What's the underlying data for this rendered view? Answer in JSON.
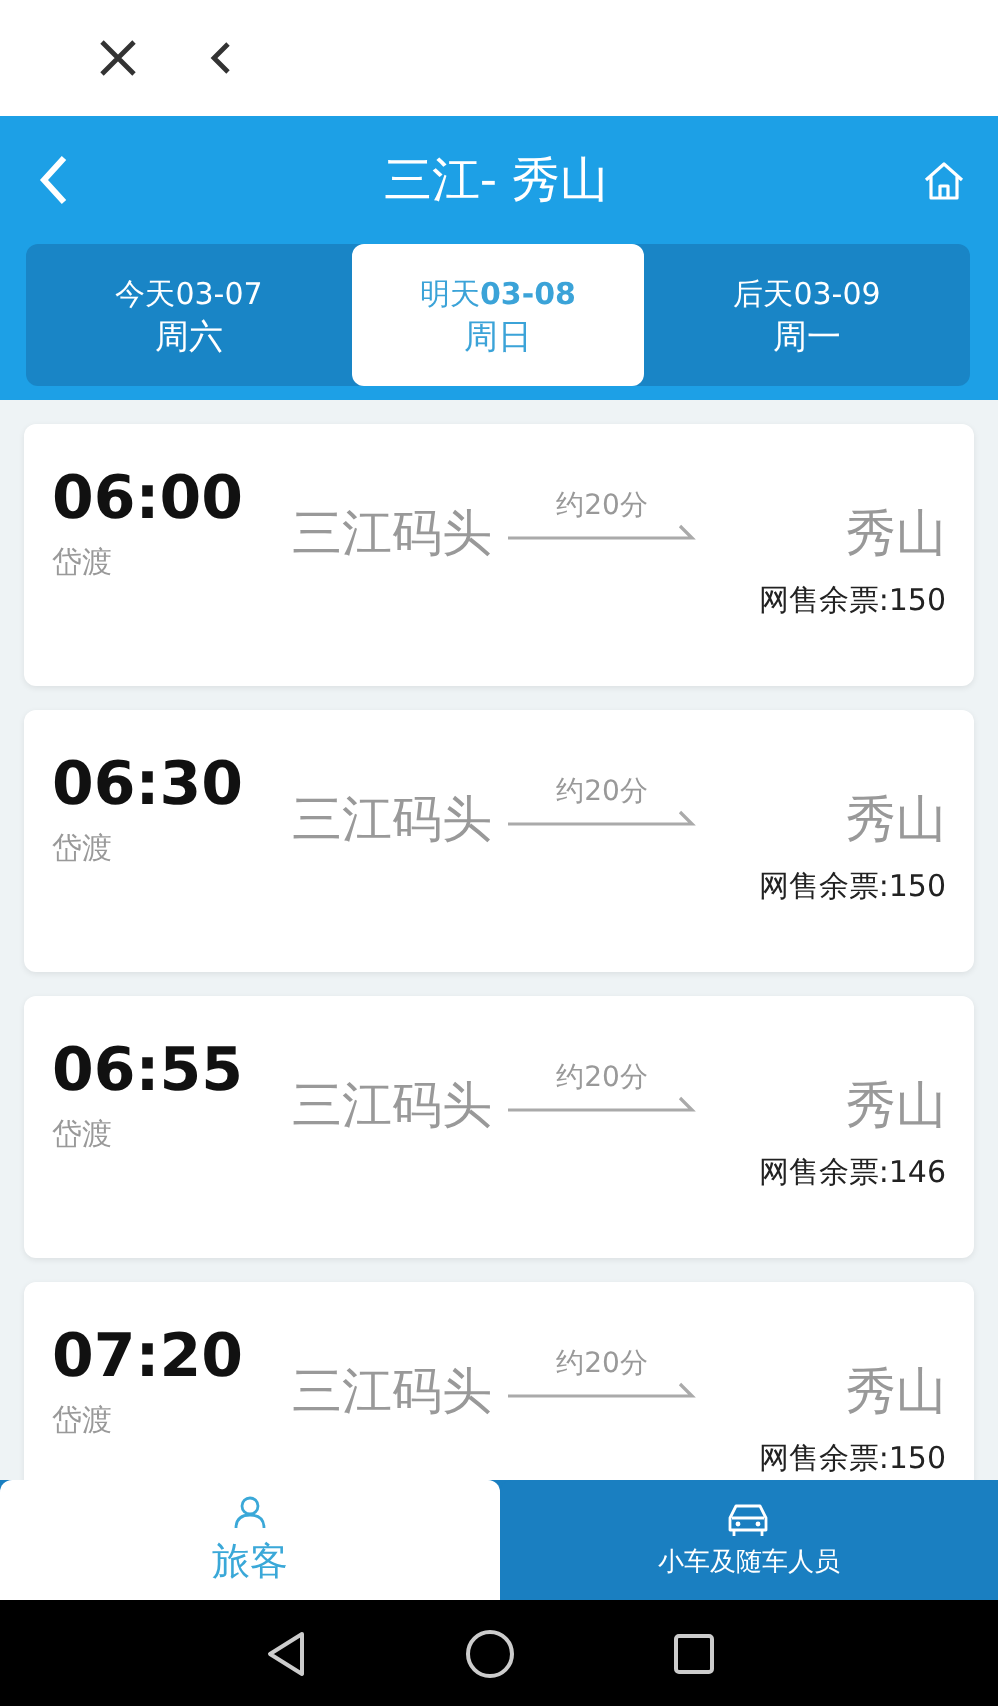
{
  "header": {
    "title": "三江- 秀山"
  },
  "date_tabs": [
    {
      "day": "今天",
      "date": "03-07",
      "weekday": "周六",
      "selected": false
    },
    {
      "day": "明天",
      "date": "03-08",
      "weekday": "周日",
      "selected": true
    },
    {
      "day": "后天",
      "date": "03-09",
      "weekday": "周一",
      "selected": false
    }
  ],
  "trips": [
    {
      "time": "06:00",
      "operator": "岱渡",
      "origin": "三江码头",
      "duration": "约20分",
      "destination": "秀山",
      "tickets": "网售余票:150"
    },
    {
      "time": "06:30",
      "operator": "岱渡",
      "origin": "三江码头",
      "duration": "约20分",
      "destination": "秀山",
      "tickets": "网售余票:150"
    },
    {
      "time": "06:55",
      "operator": "岱渡",
      "origin": "三江码头",
      "duration": "约20分",
      "destination": "秀山",
      "tickets": "网售余票:146"
    },
    {
      "time": "07:20",
      "operator": "岱渡",
      "origin": "三江码头",
      "duration": "约20分",
      "destination": "秀山",
      "tickets": "网售余票:150"
    }
  ],
  "bottom_tabs": [
    {
      "kind": "passenger",
      "label": "旅客",
      "selected": true
    },
    {
      "kind": "car",
      "label": "小车及随车人员",
      "selected": false
    }
  ]
}
